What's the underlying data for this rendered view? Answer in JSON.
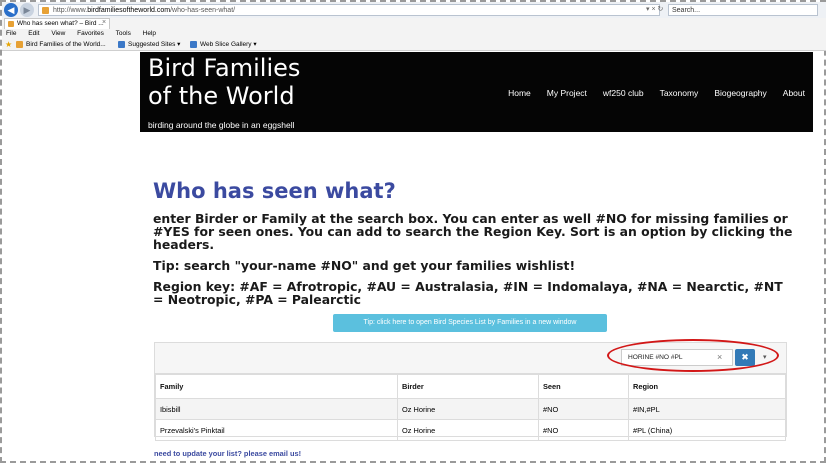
{
  "browser": {
    "url_prefix": "http://www.",
    "url_host": "birdfamiliesoftheworld.com",
    "url_path": "/who-has-seen-what/",
    "url_controls": "▾ × ↻",
    "search_placeholder": "Search...",
    "tab_title": "Who has seen what? – Bird ...",
    "tab_close": "×",
    "menu": [
      "File",
      "Edit",
      "View",
      "Favorites",
      "Tools",
      "Help"
    ],
    "favorites": [
      "Bird Families of the World...",
      "Suggested Sites ▾",
      "Web Slice Gallery ▾"
    ]
  },
  "site": {
    "title_line1": "Bird Families",
    "title_line2": "of the World",
    "tagline": "birding around the globe in an eggshell",
    "nav": [
      "Home",
      "My Project",
      "wf250 club",
      "Taxonomy",
      "Biogeography",
      "About"
    ]
  },
  "content": {
    "title": "Who has seen what?",
    "paragraph1": "enter Birder or Family at the search box. You can enter as well #NO for missing families or #YES for seen ones. You can add to search the Region Key. Sort is an option by clicking the headers.",
    "paragraph2": "Tip: search \"your-name #NO\" and get your families wishlist!",
    "paragraph3": "Region key: #AF = Afrotropic, #AU = Australasia, #IN = Indomalaya, #NA = Nearctic, #NT = Neotropic, #PA = Palearctic",
    "tip_button": "Tip: click here to open Bird Species List by Families in a new window"
  },
  "table": {
    "filter_value": "HORINE #NO #PL",
    "clear_symbol": "×",
    "filter_button": "✖",
    "caret": "▾",
    "headers": [
      "Family",
      "Birder",
      "Seen",
      "Region"
    ],
    "rows": [
      [
        "Ibisbill",
        "Oz Horine",
        "#NO",
        "#IN,#PL"
      ],
      [
        "Przevalski's Pinktail",
        "Oz Horine",
        "#NO",
        "#PL (China)"
      ]
    ]
  },
  "footer": {
    "link": "need to update your list? please email us!"
  },
  "colors": {
    "title_blue": "#3b4aa0",
    "tip_button": "#5bc0de",
    "filter_button": "#337ab7",
    "highlight": "#d21717"
  }
}
